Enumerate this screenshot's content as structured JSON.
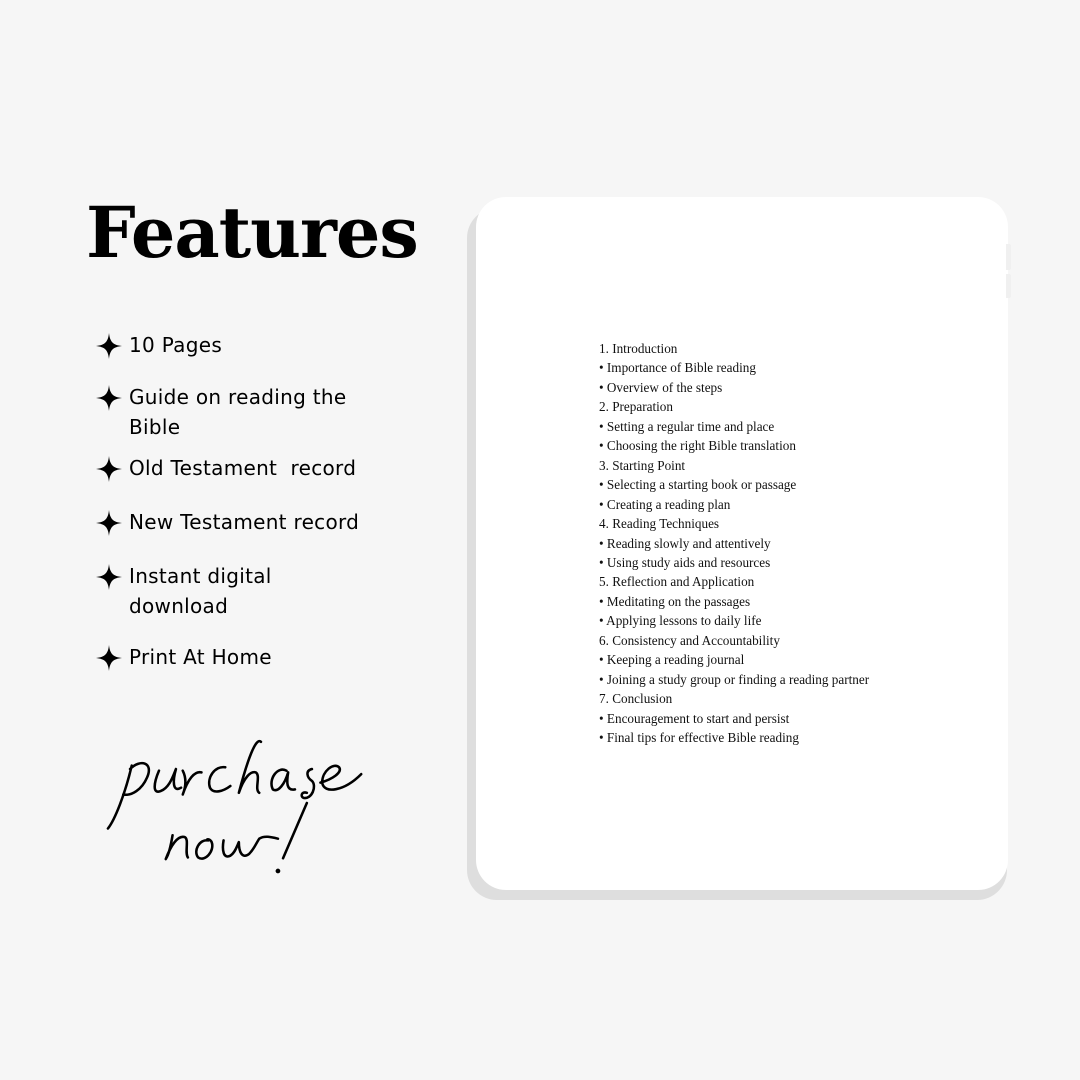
{
  "title": "Features",
  "features": [
    {
      "icon": "sparkle-icon",
      "label": "10 Pages"
    },
    {
      "icon": "sparkle-icon",
      "label": "Guide on reading the Bible"
    },
    {
      "icon": "sparkle-icon",
      "label": "Old Testament  record"
    },
    {
      "icon": "sparkle-icon",
      "label": "New Testament record"
    },
    {
      "icon": "sparkle-icon",
      "label": "Instant digital download"
    },
    {
      "icon": "sparkle-icon",
      "label": "Print At Home"
    }
  ],
  "call_to_action": "purchase now!",
  "device_page": {
    "toc": [
      "1. Introduction",
      "• Importance of Bible reading",
      "• Overview of the steps",
      "2. Preparation",
      "• Setting a regular time and place",
      "• Choosing the right Bible translation",
      "3. Starting Point",
      "• Selecting a starting book or passage",
      "• Creating a reading plan",
      "4. Reading Techniques",
      "• Reading slowly and attentively",
      "• Using study aids and resources",
      "5. Reflection and Application",
      "• Meditating on the passages",
      "• Applying lessons to daily life",
      "6. Consistency and Accountability",
      "• Keeping a reading journal",
      "• Joining a study group or finding a reading partner",
      "7. Conclusion",
      "• Encouragement to start and persist",
      "• Final tips for effective Bible reading"
    ]
  },
  "colors": {
    "background": "#f6f6f6",
    "text": "#000000",
    "device": "#ffffff",
    "device_shadow": "#dedede"
  }
}
